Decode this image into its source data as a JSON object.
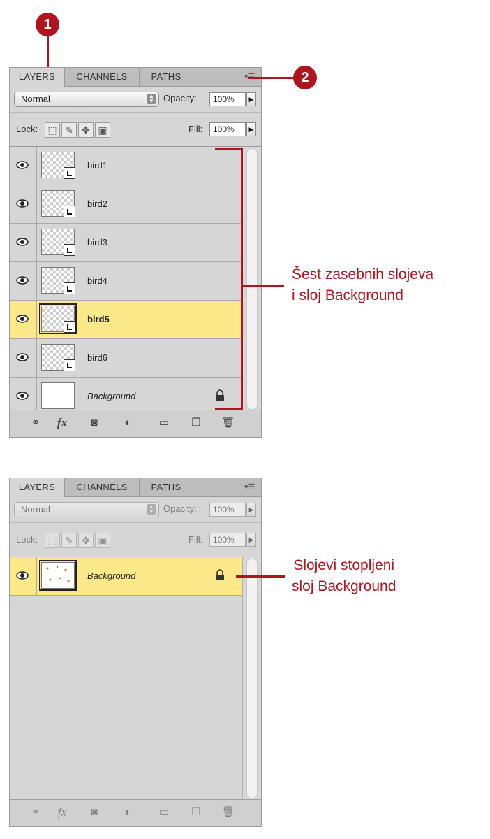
{
  "colors": {
    "annotation": "#b0141e",
    "selected_layer": "#fbe889",
    "panel": "#d6d6d6"
  },
  "badges": [
    "1",
    "2"
  ],
  "panel_top": {
    "tabs": [
      "LAYERS",
      "CHANNELS",
      "PATHS"
    ],
    "blend_mode": "Normal",
    "opacity_label": "Opacity:",
    "opacity_value": "100%",
    "lock_label": "Lock:",
    "fill_label": "Fill:",
    "fill_value": "100%",
    "layers": [
      {
        "name": "bird1",
        "selected": false
      },
      {
        "name": "bird2",
        "selected": false
      },
      {
        "name": "bird3",
        "selected": false
      },
      {
        "name": "bird4",
        "selected": false
      },
      {
        "name": "bird5",
        "selected": true
      },
      {
        "name": "bird6",
        "selected": false
      },
      {
        "name": "Background",
        "selected": false,
        "locked": true
      }
    ],
    "footer_icons": [
      "link-icon",
      "fx-icon",
      "mask-icon",
      "adjustment-icon",
      "folder-icon",
      "new-layer-icon",
      "trash-icon"
    ]
  },
  "panel_bottom": {
    "tabs": [
      "LAYERS",
      "CHANNELS",
      "PATHS"
    ],
    "blend_mode": "Normal",
    "opacity_label": "Opacity:",
    "opacity_value": "100%",
    "lock_label": "Lock:",
    "fill_label": "Fill:",
    "fill_value": "100%",
    "layers": [
      {
        "name": "Background",
        "selected": true,
        "locked": true
      }
    ]
  },
  "callouts": {
    "top_line1": "Šest zasebnih slojeva",
    "top_line2": "i sloj Background",
    "bottom_line1": "Slojevi stopljeni",
    "bottom_line2": "sloj Background"
  },
  "footer_glyphs": {
    "fx": "fx"
  }
}
